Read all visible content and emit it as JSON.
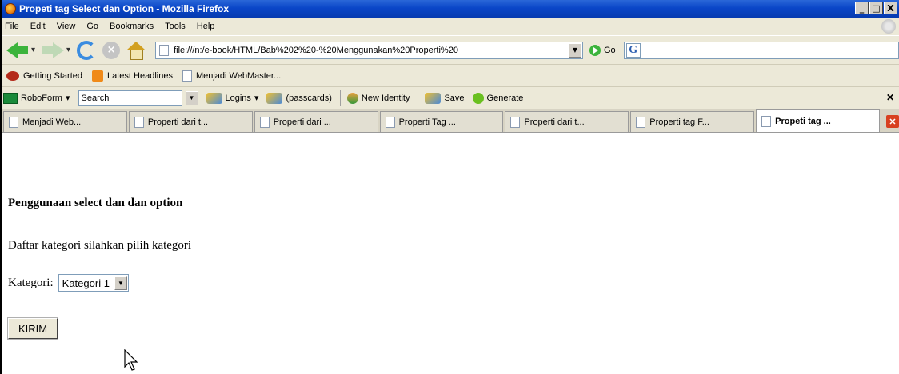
{
  "window": {
    "title": "Propeti tag Select dan Option - Mozilla Firefox",
    "buttons": [
      "_",
      "□",
      "X"
    ]
  },
  "menu": [
    "File",
    "Edit",
    "View",
    "Go",
    "Bookmarks",
    "Tools",
    "Help"
  ],
  "nav": {
    "url": "file:///n:/e-book/HTML/Bab%202%20-%20Menggunakan%20Properti%20",
    "go_label": "Go",
    "search_engine_glyph": "G",
    "search_value": ""
  },
  "bookmarks": [
    "Getting Started",
    "Latest Headlines",
    "Menjadi WebMaster..."
  ],
  "roboform": {
    "brand": "RoboForm",
    "search_value": "Search",
    "logins_label": "Logins",
    "passcards_label": "(passcards)",
    "new_identity_label": "New Identity",
    "save_label": "Save",
    "generate_label": "Generate"
  },
  "tabs": [
    {
      "label": "Menjadi Web..."
    },
    {
      "label": "Properti dari t..."
    },
    {
      "label": "Properti dari ..."
    },
    {
      "label": "Properti Tag ..."
    },
    {
      "label": "Properti dari t..."
    },
    {
      "label": "Properti tag F..."
    },
    {
      "label": "Propeti tag ..."
    }
  ],
  "page": {
    "heading": "Penggunaan select dan dan option",
    "description": "Daftar kategori silahkan pilih kategori",
    "category_label": "Kategori:",
    "category_selected": "Kategori 1",
    "submit_label": "KIRIM"
  }
}
